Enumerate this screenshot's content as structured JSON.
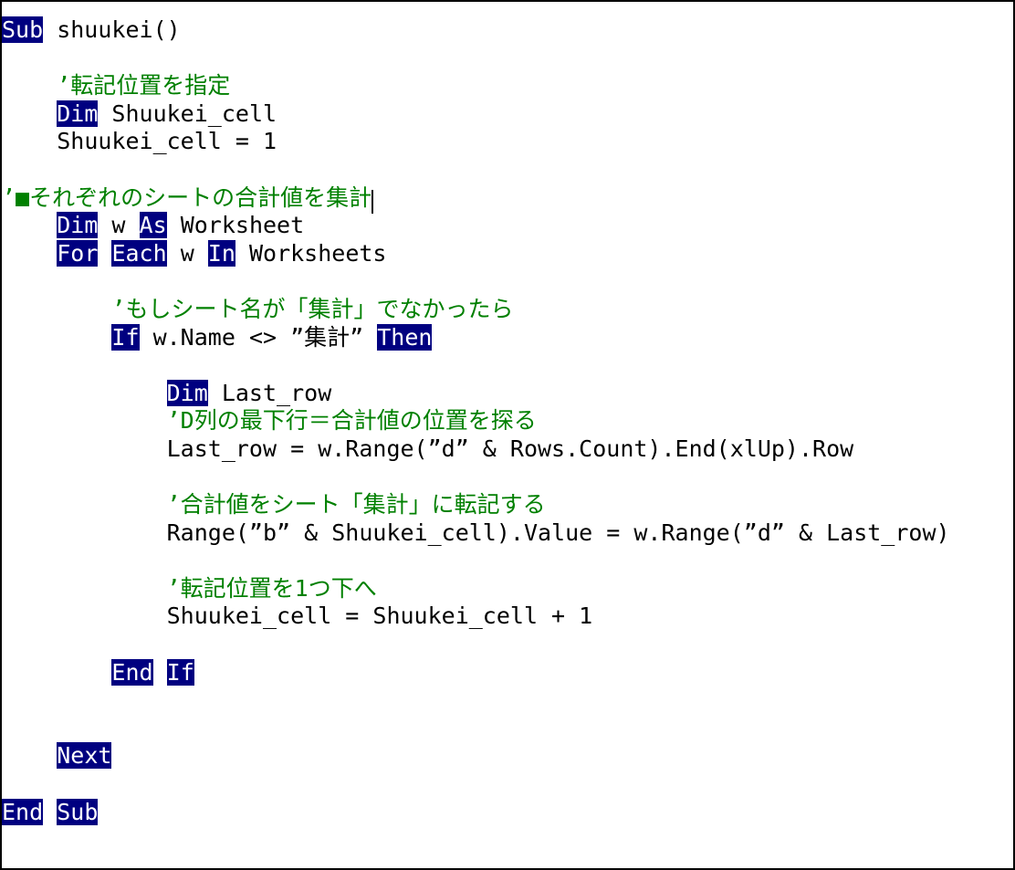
{
  "editor": {
    "name": "vba-code-editor",
    "language": "VBA",
    "colors": {
      "background": "#ffffff",
      "text": "#000000",
      "comment": "#008000",
      "keyword_text": "#ffffff",
      "keyword_highlight": "#000080",
      "border": "#000000"
    },
    "caret_line_index": 5
  },
  "lines": [
    {
      "indent": "",
      "tokens": [
        {
          "type": "keyword",
          "text": "Sub"
        },
        {
          "type": "plain",
          "text": " shuukei()"
        }
      ]
    },
    {
      "indent": "",
      "tokens": []
    },
    {
      "indent": "    ",
      "tokens": [
        {
          "type": "comment",
          "text": "’転記位置を指定"
        }
      ]
    },
    {
      "indent": "    ",
      "tokens": [
        {
          "type": "keyword",
          "text": "Dim"
        },
        {
          "type": "plain",
          "text": " Shuukei_cell"
        }
      ]
    },
    {
      "indent": "    ",
      "tokens": [
        {
          "type": "plain",
          "text": "Shuukei_cell = 1"
        }
      ]
    },
    {
      "indent": "",
      "tokens": []
    },
    {
      "indent": "",
      "tokens": [
        {
          "type": "comment",
          "text": "’■それぞれのシートの合計値を集計"
        },
        {
          "type": "caret",
          "text": ""
        }
      ]
    },
    {
      "indent": "    ",
      "tokens": [
        {
          "type": "keyword",
          "text": "Dim"
        },
        {
          "type": "plain",
          "text": " w "
        },
        {
          "type": "keyword",
          "text": "As"
        },
        {
          "type": "plain",
          "text": " Worksheet"
        }
      ]
    },
    {
      "indent": "    ",
      "tokens": [
        {
          "type": "keyword",
          "text": "For"
        },
        {
          "type": "plain",
          "text": " "
        },
        {
          "type": "keyword",
          "text": "Each"
        },
        {
          "type": "plain",
          "text": " w "
        },
        {
          "type": "keyword",
          "text": "In"
        },
        {
          "type": "plain",
          "text": " Worksheets"
        }
      ]
    },
    {
      "indent": "",
      "tokens": []
    },
    {
      "indent": "        ",
      "tokens": [
        {
          "type": "comment",
          "text": "’もしシート名が「集計」でなかったら"
        }
      ]
    },
    {
      "indent": "        ",
      "tokens": [
        {
          "type": "keyword",
          "text": "If"
        },
        {
          "type": "plain",
          "text": " w.Name <> ”集計” "
        },
        {
          "type": "keyword",
          "text": "Then"
        }
      ]
    },
    {
      "indent": "",
      "tokens": []
    },
    {
      "indent": "            ",
      "tokens": [
        {
          "type": "keyword",
          "text": "Dim"
        },
        {
          "type": "plain",
          "text": " Last_row"
        }
      ]
    },
    {
      "indent": "            ",
      "tokens": [
        {
          "type": "comment",
          "text": "’D列の最下行＝合計値の位置を探る"
        }
      ]
    },
    {
      "indent": "            ",
      "tokens": [
        {
          "type": "plain",
          "text": "Last_row = w.Range(”d” & Rows.Count).End(xlUp).Row"
        }
      ]
    },
    {
      "indent": "",
      "tokens": []
    },
    {
      "indent": "            ",
      "tokens": [
        {
          "type": "comment",
          "text": "’合計値をシート「集計」に転記する"
        }
      ]
    },
    {
      "indent": "            ",
      "tokens": [
        {
          "type": "plain",
          "text": "Range(”b” & Shuukei_cell).Value = w.Range(”d” & Last_row)"
        }
      ]
    },
    {
      "indent": "",
      "tokens": []
    },
    {
      "indent": "            ",
      "tokens": [
        {
          "type": "comment",
          "text": "’転記位置を1つ下へ"
        }
      ]
    },
    {
      "indent": "            ",
      "tokens": [
        {
          "type": "plain",
          "text": "Shuukei_cell = Shuukei_cell + 1"
        }
      ]
    },
    {
      "indent": "",
      "tokens": []
    },
    {
      "indent": "        ",
      "tokens": [
        {
          "type": "keyword",
          "text": "End"
        },
        {
          "type": "plain",
          "text": " "
        },
        {
          "type": "keyword",
          "text": "If"
        }
      ]
    },
    {
      "indent": "",
      "tokens": []
    },
    {
      "indent": "",
      "tokens": []
    },
    {
      "indent": "    ",
      "tokens": [
        {
          "type": "keyword",
          "text": "Next"
        }
      ]
    },
    {
      "indent": "",
      "tokens": []
    },
    {
      "indent": "",
      "tokens": [
        {
          "type": "keyword",
          "text": "End"
        },
        {
          "type": "plain",
          "text": " "
        },
        {
          "type": "keyword",
          "text": "Sub"
        }
      ]
    }
  ]
}
